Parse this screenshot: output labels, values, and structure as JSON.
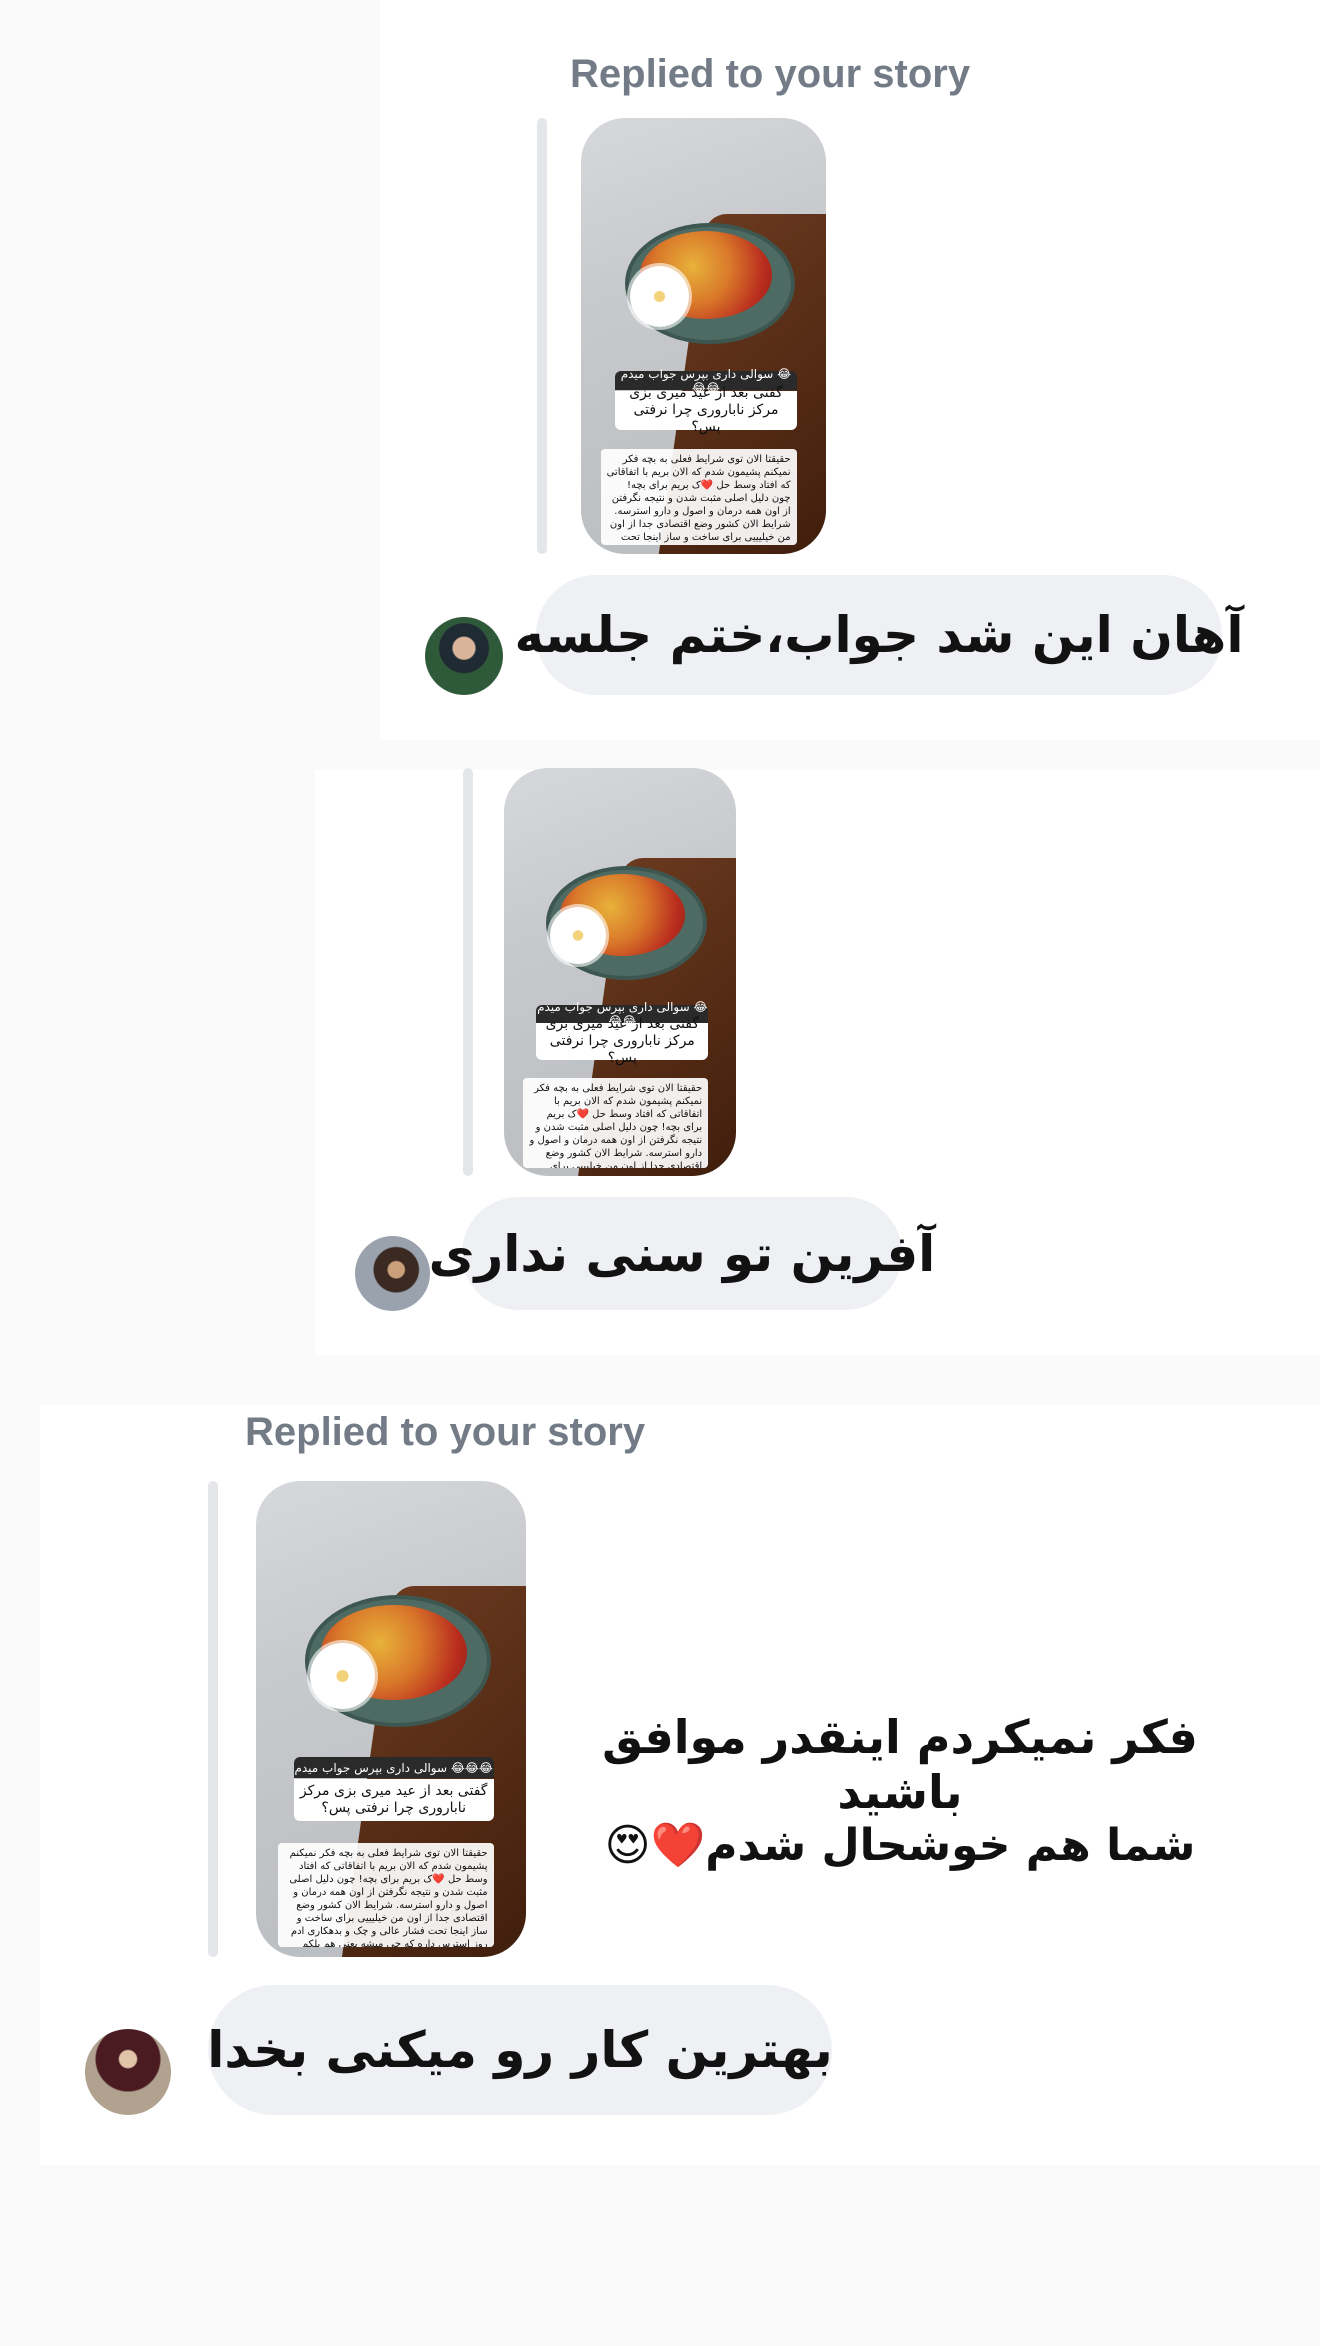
{
  "story": {
    "question_header": "سوالی داری بپرس جواب میدم 😂😂😂",
    "question_text": "گفتی بعد از عید میری بزی مرکز ناباروری چرا نرفتی پس؟",
    "answer_text": "حقیقتا الان توی شرایط فعلی به بچه فکر نمیکنم پشیمون شدم که الان بریم با اتفاقاتی که افتاد وسط حل ❤️ک بریم برای بچه! چون دلیل اصلی مثبت شدن و نتیجه نگرفتن از اون همه درمان و اصول و دارو استرسه. شرایط الان کشور وضع اقتصادی جدا از اون من خیلیییی برای ساخت و ساز اینجا تحت فشار عالی و چک و بدهکاری ادم روز استرس داره که چی میشه یعنی هم پلکم داره که فکرم زیاده و واقعا وقت استرس نداره من سنی ندارم وقت زیاده ببینیم خدا چی میخواد"
  },
  "messages": [
    {
      "replied_label": "Replied to your story",
      "text": "آهان این شد جواب،ختم جلسه"
    },
    {
      "text": "آفرین تو سنی نداری"
    },
    {
      "replied_label": "Replied to your story",
      "sent_text_line1": "فکر نمیکردم اینقدر موافق باشید",
      "sent_text_line2": "شما هم خوشحال شدم❤️😍",
      "text": "بهترین کار رو میکنی بخدا"
    }
  ]
}
